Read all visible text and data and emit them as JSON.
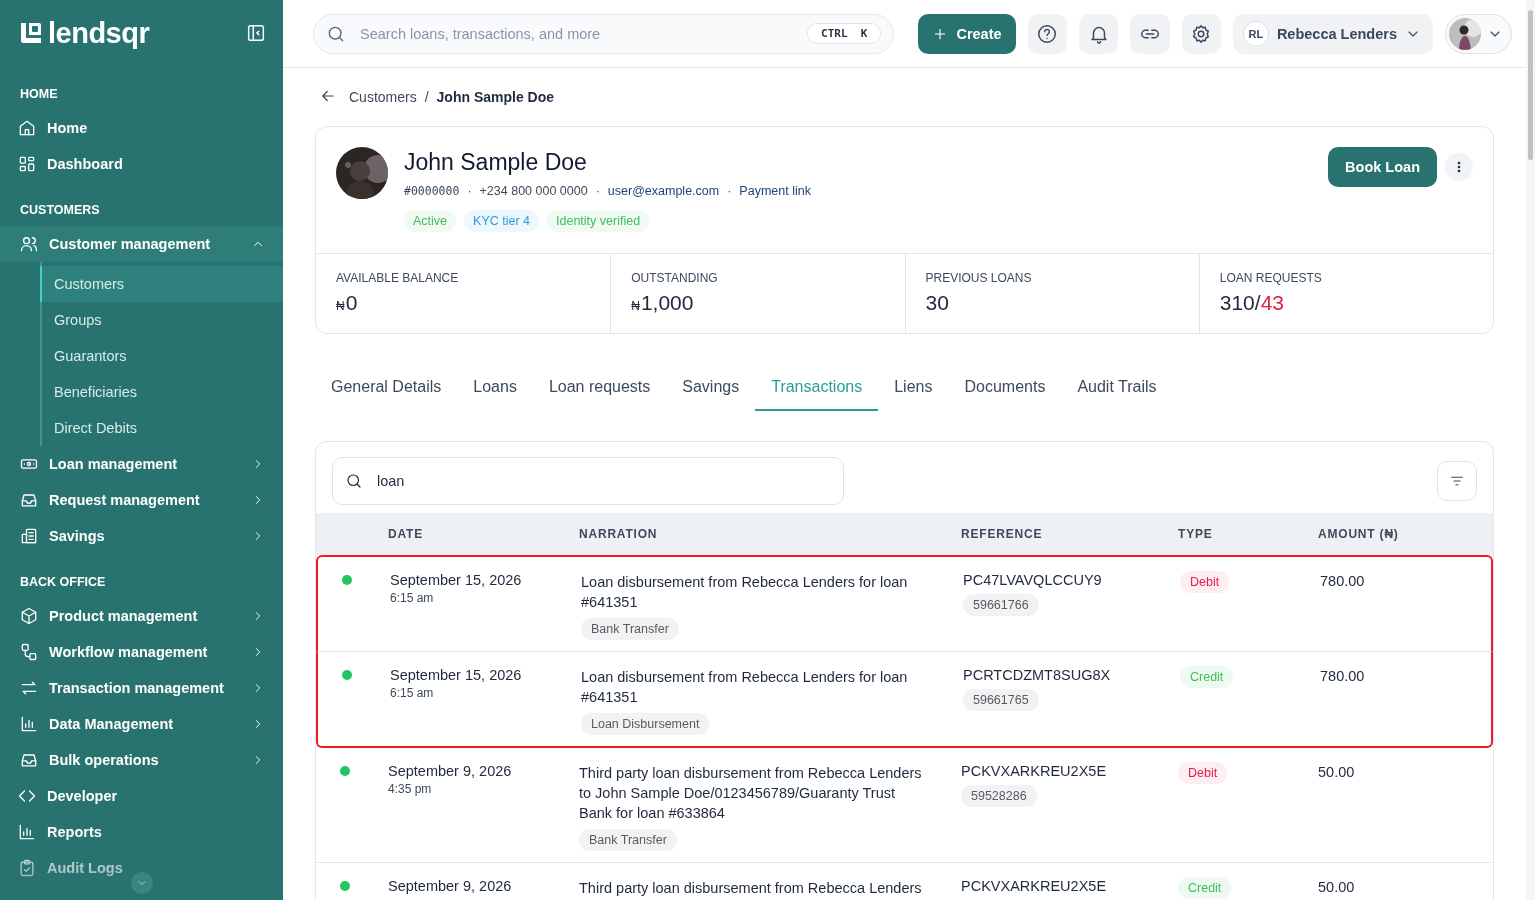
{
  "sidebar": {
    "logo": "lendsqr",
    "sections": [
      {
        "title": "HOME",
        "items": [
          {
            "label": "Home",
            "kind": "link"
          },
          {
            "label": "Dashboard",
            "kind": "link"
          }
        ]
      },
      {
        "title": "CUSTOMERS",
        "items": [
          {
            "label": "Customer management",
            "kind": "group",
            "expanded": true,
            "children": [
              {
                "label": "Customers",
                "selected": true
              },
              {
                "label": "Groups",
                "selected": false
              },
              {
                "label": "Guarantors",
                "selected": false
              },
              {
                "label": "Beneficiaries",
                "selected": false
              },
              {
                "label": "Direct Debits",
                "selected": false
              }
            ]
          },
          {
            "label": "Loan management",
            "kind": "group",
            "expanded": false
          },
          {
            "label": "Request management",
            "kind": "group",
            "expanded": false
          },
          {
            "label": "Savings",
            "kind": "group",
            "expanded": false
          }
        ]
      },
      {
        "title": "BACK OFFICE",
        "items": [
          {
            "label": "Product management",
            "kind": "group",
            "expanded": false
          },
          {
            "label": "Workflow management",
            "kind": "group",
            "expanded": false
          },
          {
            "label": "Transaction management",
            "kind": "group",
            "expanded": false
          },
          {
            "label": "Data Management",
            "kind": "group",
            "expanded": false
          },
          {
            "label": "Bulk operations",
            "kind": "group",
            "expanded": false
          },
          {
            "label": "Developer",
            "kind": "link"
          },
          {
            "label": "Reports",
            "kind": "link"
          },
          {
            "label": "Audit Logs",
            "kind": "link"
          }
        ]
      }
    ]
  },
  "topbar": {
    "search": {
      "placeholder": "Search loans, transactions, and more",
      "shortcut": "CTRL  K"
    },
    "create": "Create",
    "user": {
      "initials": "RL",
      "name": "Rebecca Lenders"
    }
  },
  "breadcrumb": [
    "Customers",
    "John Sample Doe"
  ],
  "breadcrumb_separator": "/",
  "profile": {
    "name": "John Sample Doe",
    "id": "#0000000",
    "phone": "+234 800 000 0000",
    "email": "user@example.com",
    "payment_link": "Payment link",
    "separator": "·",
    "tags": [
      {
        "label": "Active",
        "color": "#3cbf5c"
      },
      {
        "label": "KYC tier 4",
        "color": "#2b9fd9"
      },
      {
        "label": "Identity verified",
        "color": "#3cbf5c"
      }
    ],
    "action": "Book Loan",
    "stats": [
      {
        "label": "AVAILABLE BALANCE",
        "currency": "₦",
        "parts": [
          {
            "text": "0",
            "kind": "normal"
          }
        ]
      },
      {
        "label": "OUTSTANDING",
        "currency": "₦",
        "parts": [
          {
            "text": "1,000",
            "kind": "normal"
          }
        ]
      },
      {
        "label": "PREVIOUS LOANS",
        "parts": [
          {
            "text": "30",
            "kind": "normal"
          }
        ]
      },
      {
        "label": "LOAN REQUESTS",
        "parts": [
          {
            "text": "310/",
            "kind": "normal"
          },
          {
            "text": "43",
            "kind": "alert"
          }
        ]
      }
    ]
  },
  "tabs": [
    {
      "label": "General Details",
      "selected": false
    },
    {
      "label": "Loans",
      "selected": false
    },
    {
      "label": "Loan requests",
      "selected": false
    },
    {
      "label": "Savings",
      "selected": false
    },
    {
      "label": "Transactions",
      "selected": true
    },
    {
      "label": "Liens",
      "selected": false
    },
    {
      "label": "Documents",
      "selected": false
    },
    {
      "label": "Audit Trails",
      "selected": false
    }
  ],
  "transactions": {
    "search": {
      "value": "loan"
    },
    "table": {
      "columns": [
        "DATE",
        "NARRATION",
        "REFERENCE",
        "TYPE",
        "AMOUNT (₦)"
      ],
      "rows": [
        {
          "color": "#22c55e",
          "date": "September 15, 2026",
          "time": "6:15 am",
          "narration": "Loan disbursement from Rebecca Lenders for loan #641351",
          "channel": "Bank Transfer",
          "reference": "PC47LVAVQLCCUY9",
          "ref_id": "59661766",
          "type": {
            "label": "Debit",
            "kind": "debit"
          },
          "amount": "780.00",
          "highlighted": true
        },
        {
          "color": "#22c55e",
          "date": "September 15, 2026",
          "time": "6:15 am",
          "narration": "Loan disbursement from Rebecca Lenders for loan #641351",
          "channel": "Loan Disbursement",
          "reference": "PCRTCDZMT8SUG8X",
          "ref_id": "59661765",
          "type": {
            "label": "Credit",
            "kind": "credit"
          },
          "amount": "780.00",
          "highlighted": true
        },
        {
          "color": "#22c55e",
          "date": "September 9, 2026",
          "time": "4:35 pm",
          "narration": "Third party loan disbursement from Rebecca Lenders to John Sample Doe/0123456789/Guaranty Trust Bank for loan #633864",
          "channel": "Bank Transfer",
          "reference": "PCKVXARKREU2X5E",
          "ref_id": "59528286",
          "type": {
            "label": "Debit",
            "kind": "debit"
          },
          "amount": "50.00",
          "highlighted": false
        },
        {
          "color": "#22c55e",
          "date": "September 9, 2026",
          "narration": "Third party loan disbursement from Rebecca Lenders",
          "reference": "PCKVXARKREU2X5E",
          "type": {
            "label": "Credit",
            "kind": "credit"
          },
          "amount": "50.00",
          "highlighted": false
        }
      ]
    }
  }
}
